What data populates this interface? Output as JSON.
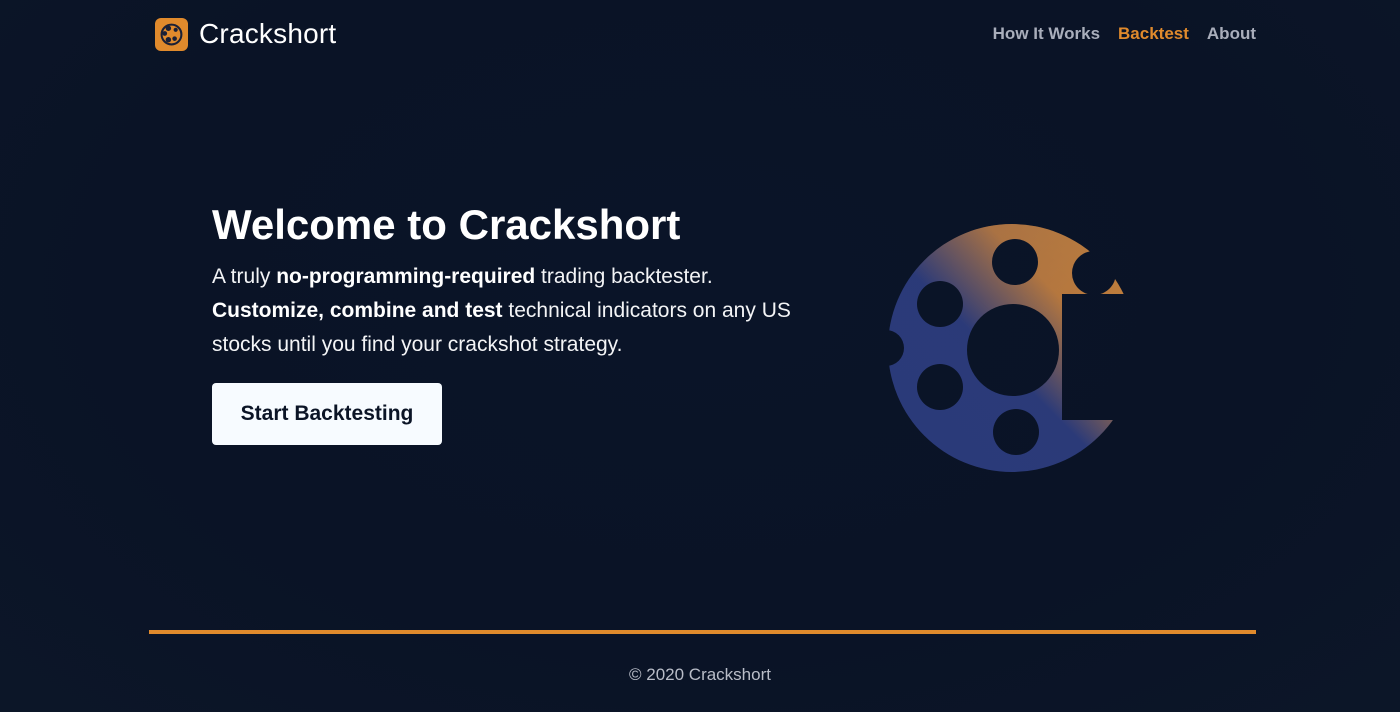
{
  "brand": {
    "name": "Crackshort",
    "logo_icon": "crackshort-logo-icon",
    "accent_color": "#e08a2c"
  },
  "nav": {
    "items": [
      {
        "label": "How It Works"
      },
      {
        "label": "Backtest",
        "active": true
      },
      {
        "label": "About"
      }
    ]
  },
  "hero": {
    "title": "Welcome to Crackshort",
    "desc": {
      "p1": "A truly ",
      "b1": "no-programming-required",
      "p2": " trading backtester.",
      "b2": "Customize, combine and test",
      "p3": " technical indicators on any US stocks until you find your crackshot strategy."
    },
    "cta_label": "Start Backtesting",
    "graphic_icon": "crackshort-cracker-icon"
  },
  "footer": {
    "copyright": "© 2020 Crackshort"
  },
  "colors": {
    "background": "#0b1426",
    "accent": "#e08a2c",
    "graphic_blue": "#2a3a7a"
  }
}
